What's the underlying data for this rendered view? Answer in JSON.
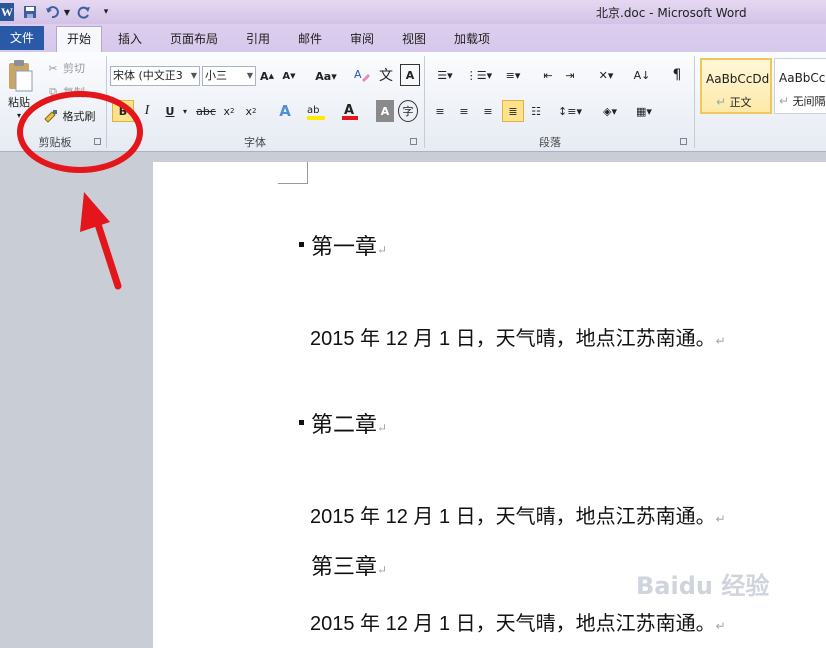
{
  "window": {
    "title": "北京.doc - Microsoft Word",
    "app_icon": "W"
  },
  "tabs": [
    {
      "label": "文件"
    },
    {
      "label": "开始"
    },
    {
      "label": "插入"
    },
    {
      "label": "页面布局"
    },
    {
      "label": "引用"
    },
    {
      "label": "邮件"
    },
    {
      "label": "审阅"
    },
    {
      "label": "视图"
    },
    {
      "label": "加载项"
    }
  ],
  "clipboard": {
    "paste_label": "粘贴",
    "cut_label": "剪切",
    "copy_label": "复制",
    "format_painter_label": "格式刷",
    "group_label": "剪贴板"
  },
  "font": {
    "font_name": "宋体 (中文正3",
    "font_size": "小三",
    "group_label": "字体"
  },
  "paragraph": {
    "group_label": "段落"
  },
  "styles": {
    "items": [
      {
        "sample": "AaBbCcDd",
        "name": "正文"
      },
      {
        "sample": "AaBbCcD",
        "name": "无间隔"
      }
    ]
  },
  "document": {
    "chapter1": "第一章",
    "line1": "2015 年 12 月 1 日，天气晴，地点江苏南通。",
    "chapter2": "第二章",
    "line2": "2015 年 12 月 1 日，天气晴，地点江苏南通。",
    "chapter3": "第三章",
    "line3": "2015 年 12 月 1 日，天气晴，地点江苏南通。",
    "para_mark": "↵"
  },
  "watermark": "Baidu 经验",
  "colors": {
    "file_tab": "#2a59a8",
    "annotation_red": "#e3161b",
    "style_active": "#f1c75a"
  }
}
